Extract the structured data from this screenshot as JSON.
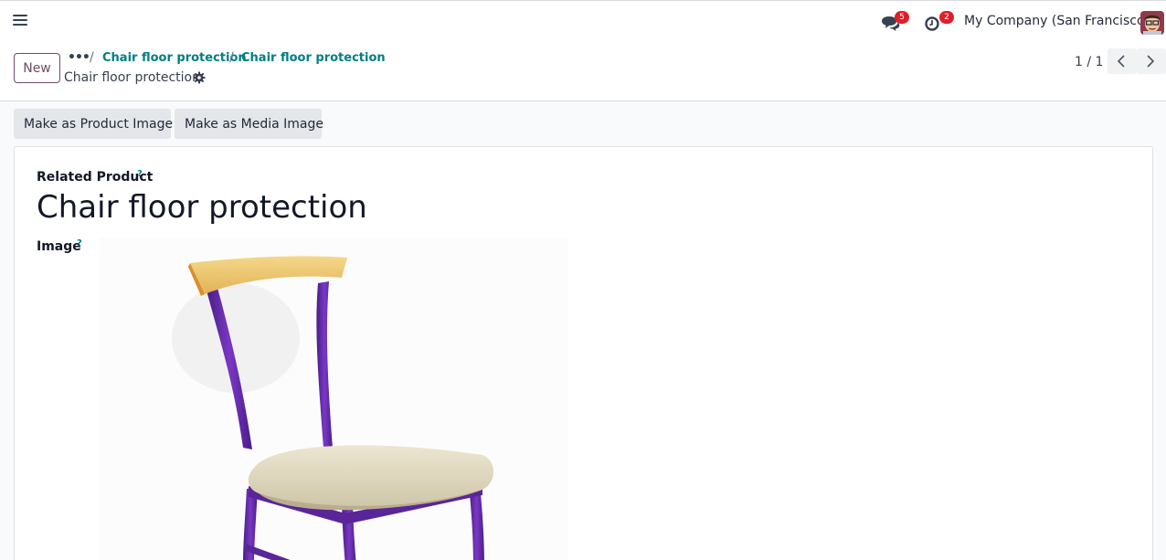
{
  "topbar": {
    "messages_badge": "5",
    "activities_badge": "2",
    "company": "My Company (San Francisco)"
  },
  "control_panel": {
    "new_label": "New",
    "breadcrumb": [
      "Chair floor protection",
      "Chair floor protection"
    ],
    "record_name": "Chair floor protection",
    "pager": "1 / 1"
  },
  "actions": {
    "product_image": "Make as Product Image",
    "media_image": "Make as Media Image"
  },
  "form": {
    "related_product_label": "Related Product",
    "help_mark": "?",
    "product_name": "Chair floor protection",
    "image_label": "Image"
  },
  "colors": {
    "brand": "#714b67",
    "link": "#017e84",
    "badge": "#e11d2a"
  }
}
